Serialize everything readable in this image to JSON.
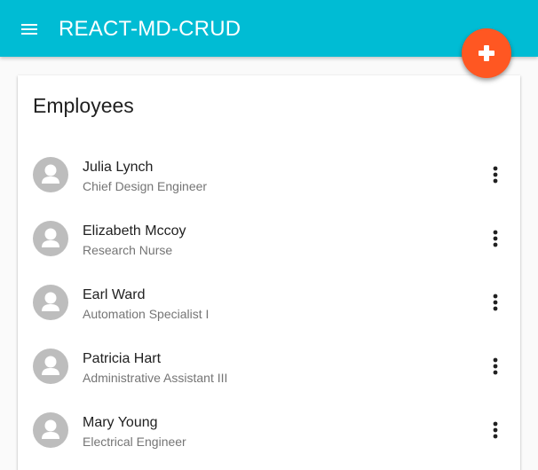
{
  "app_bar": {
    "title": "REACT-MD-CRUD",
    "background_color": "#00bcd4",
    "menu_icon": "menu-icon"
  },
  "fab": {
    "icon": "add-icon",
    "color": "#ff5722"
  },
  "card": {
    "title": "Employees"
  },
  "employees": [
    {
      "name": "Julia Lynch",
      "title": "Chief Design Engineer"
    },
    {
      "name": "Elizabeth Mccoy",
      "title": "Research Nurse"
    },
    {
      "name": "Earl Ward",
      "title": "Automation Specialist I"
    },
    {
      "name": "Patricia Hart",
      "title": "Administrative Assistant III"
    },
    {
      "name": "Mary Young",
      "title": "Electrical Engineer"
    }
  ],
  "list_item_icons": {
    "avatar": "person-avatar-icon",
    "menu": "more-vert-icon"
  }
}
